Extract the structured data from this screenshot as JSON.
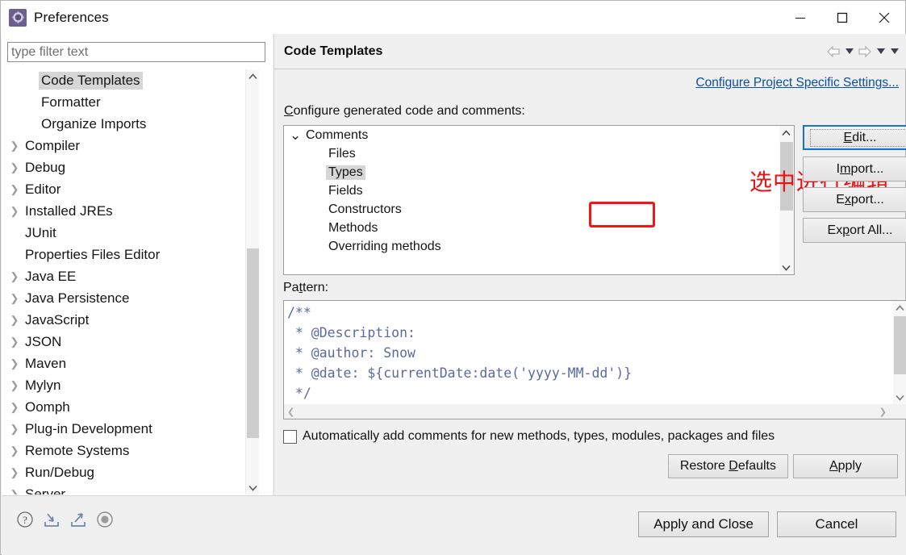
{
  "window": {
    "title": "Preferences",
    "icon": "preferences-gear-icon",
    "controls": {
      "minimize": "—",
      "maximize": "□",
      "close": "✕"
    }
  },
  "sidebar": {
    "filter": {
      "placeholder": "type filter text",
      "value": ""
    },
    "items": [
      {
        "label": "Code Templates",
        "indent": 1,
        "expandable": false,
        "selected": true
      },
      {
        "label": "Formatter",
        "indent": 1,
        "expandable": false,
        "selected": false
      },
      {
        "label": "Organize Imports",
        "indent": 1,
        "expandable": false,
        "selected": false
      },
      {
        "label": "Compiler",
        "indent": 0,
        "expandable": true,
        "selected": false
      },
      {
        "label": "Debug",
        "indent": 0,
        "expandable": true,
        "selected": false
      },
      {
        "label": "Editor",
        "indent": 0,
        "expandable": true,
        "selected": false
      },
      {
        "label": "Installed JREs",
        "indent": 0,
        "expandable": true,
        "selected": false
      },
      {
        "label": "JUnit",
        "indent": 0,
        "expandable": false,
        "selected": false
      },
      {
        "label": "Properties Files Editor",
        "indent": 0,
        "expandable": false,
        "selected": false
      },
      {
        "label": "Java EE",
        "indent": 0,
        "expandable": true,
        "selected": false
      },
      {
        "label": "Java Persistence",
        "indent": 0,
        "expandable": true,
        "selected": false
      },
      {
        "label": "JavaScript",
        "indent": 0,
        "expandable": true,
        "selected": false
      },
      {
        "label": "JSON",
        "indent": 0,
        "expandable": true,
        "selected": false
      },
      {
        "label": "Maven",
        "indent": 0,
        "expandable": true,
        "selected": false
      },
      {
        "label": "Mylyn",
        "indent": 0,
        "expandable": true,
        "selected": false
      },
      {
        "label": "Oomph",
        "indent": 0,
        "expandable": true,
        "selected": false
      },
      {
        "label": "Plug-in Development",
        "indent": 0,
        "expandable": true,
        "selected": false
      },
      {
        "label": "Remote Systems",
        "indent": 0,
        "expandable": true,
        "selected": false
      },
      {
        "label": "Run/Debug",
        "indent": 0,
        "expandable": true,
        "selected": false
      },
      {
        "label": "Server",
        "indent": 0,
        "expandable": true,
        "selected": false
      }
    ],
    "expand_arrow_icon": "chevron-right-icon"
  },
  "page": {
    "title": "Code Templates",
    "nav": {
      "back_icon": "arrow-back-icon",
      "back_menu_icon": "caret-down-icon",
      "forward_icon": "arrow-forward-icon",
      "forward_menu_icon": "caret-down-icon",
      "view_menu_icon": "caret-down-icon"
    },
    "project_link": "Configure Project Specific Settings...",
    "configure_label": "Configure generated code and comments:",
    "templates": [
      {
        "label": "Comments",
        "level": 0,
        "expanded": true,
        "selected": false
      },
      {
        "label": "Files",
        "level": 1,
        "expanded": false,
        "selected": false
      },
      {
        "label": "Types",
        "level": 1,
        "expanded": false,
        "selected": true
      },
      {
        "label": "Fields",
        "level": 1,
        "expanded": false,
        "selected": false
      },
      {
        "label": "Constructors",
        "level": 1,
        "expanded": false,
        "selected": false
      },
      {
        "label": "Methods",
        "level": 1,
        "expanded": false,
        "selected": false
      },
      {
        "label": "Overriding methods",
        "level": 1,
        "expanded": false,
        "selected": false
      }
    ],
    "side_buttons": {
      "edit": "Edit...",
      "edit_mnemonic": "E",
      "import": "Import...",
      "import_mnemonic": "m",
      "export": "Export...",
      "export_mnemonic": "x",
      "export_all": "Export All...",
      "export_all_mnemonic": "p"
    },
    "pattern_label": "Pattern:",
    "pattern_code": "/**\n * @Description: \n * @author: Snow\n * @date: ${currentDate:date('yyyy-MM-dd')}\n */",
    "auto_comment_checkbox": {
      "label": "Automatically add comments for new methods, types, modules, packages and files",
      "checked": false
    },
    "restore_defaults": "Restore Defaults",
    "apply": "Apply"
  },
  "annotations": {
    "chinese_note": "选中进行编辑",
    "arrow_color": "#ee1111",
    "box_color": "#f21616",
    "box_target": "Types",
    "arrow_target": "Edit..."
  },
  "footer": {
    "icons": [
      {
        "name": "help-icon",
        "glyph": "?"
      },
      {
        "name": "import-preferences-icon",
        "glyph": "import"
      },
      {
        "name": "export-preferences-icon",
        "glyph": "export"
      },
      {
        "name": "oomph-recorder-icon",
        "glyph": "record"
      }
    ],
    "apply_and_close": "Apply and Close",
    "cancel": "Cancel"
  },
  "colors": {
    "link": "#0b4fa8",
    "accent_focus": "#1a72c4",
    "annotation_red": "#ee1111",
    "code_text": "#5b6aa0",
    "title_icon": "#6b5f90"
  }
}
